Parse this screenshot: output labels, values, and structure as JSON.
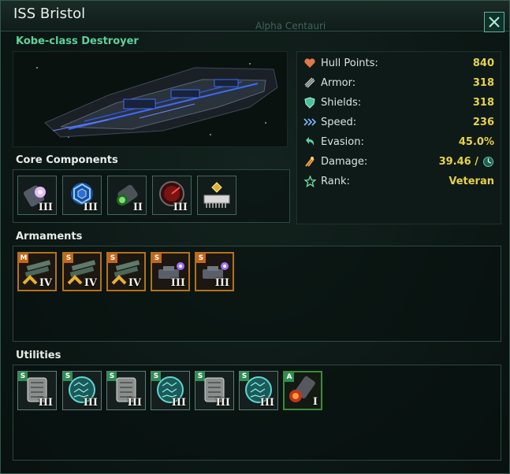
{
  "window": {
    "title": "ISS Bristol",
    "background_star_label": "Alpha Centauri"
  },
  "ship": {
    "class_name": "Kobe-class Destroyer"
  },
  "stats": [
    {
      "icon": "heart-icon",
      "label": "Hull Points:",
      "value": "840"
    },
    {
      "icon": "armor-icon",
      "label": "Armor:",
      "value": "318"
    },
    {
      "icon": "shield-icon",
      "label": "Shields:",
      "value": "318"
    },
    {
      "icon": "speed-icon",
      "label": "Speed:",
      "value": "236"
    },
    {
      "icon": "evasion-icon",
      "label": "Evasion:",
      "value": "45.0%"
    },
    {
      "icon": "damage-icon",
      "label": "Damage:",
      "value": "39.46 /"
    },
    {
      "icon": "star-icon",
      "label": "Rank:",
      "value": "Veteran"
    }
  ],
  "sections": {
    "core": "Core Components",
    "armaments": "Armaments",
    "utilities": "Utilities"
  },
  "core_components": [
    {
      "icon": "reactor-icon",
      "tier": "III"
    },
    {
      "icon": "hyperdrive-icon",
      "tier": "III"
    },
    {
      "icon": "thruster-icon",
      "tier": "II"
    },
    {
      "icon": "sensor-icon",
      "tier": "III"
    },
    {
      "icon": "combat-computer-icon",
      "tier": ""
    }
  ],
  "armaments": [
    {
      "size": "M",
      "icon": "missile-launcher-icon",
      "tier": "IV"
    },
    {
      "size": "S",
      "icon": "missile-launcher-icon",
      "tier": "IV"
    },
    {
      "size": "S",
      "icon": "missile-launcher-icon",
      "tier": "IV"
    },
    {
      "size": "S",
      "icon": "laser-icon",
      "tier": "III"
    },
    {
      "size": "S",
      "icon": "laser-icon",
      "tier": "III"
    }
  ],
  "utilities": [
    {
      "size": "S",
      "icon": "armor-plate-icon",
      "tier": "III"
    },
    {
      "size": "S",
      "icon": "shield-generator-icon",
      "tier": "III"
    },
    {
      "size": "S",
      "icon": "armor-plate-icon",
      "tier": "III"
    },
    {
      "size": "S",
      "icon": "shield-generator-icon",
      "tier": "III"
    },
    {
      "size": "S",
      "icon": "armor-plate-icon",
      "tier": "III"
    },
    {
      "size": "S",
      "icon": "shield-generator-icon",
      "tier": "III"
    },
    {
      "size": "A",
      "icon": "afterburner-icon",
      "tier": "I"
    }
  ]
}
